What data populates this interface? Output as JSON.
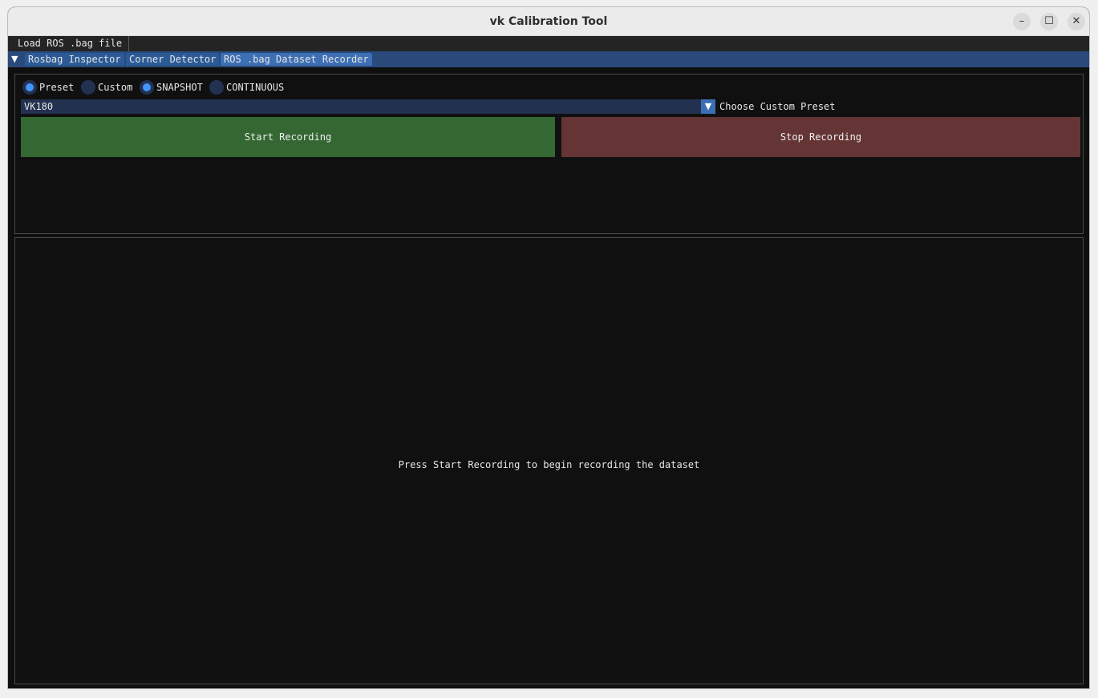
{
  "window": {
    "title": "vk Calibration Tool",
    "controls": {
      "minimize": "–",
      "maximize": "☐",
      "close": "✕"
    }
  },
  "menubar": {
    "items": [
      {
        "label": "Load ROS .bag file"
      }
    ]
  },
  "tabs": {
    "collapse_arrow": "▼",
    "items": [
      {
        "label": "Rosbag Inspector",
        "active": false
      },
      {
        "label": "Corner Detector",
        "active": false
      },
      {
        "label": "ROS .bag Dataset Recorder",
        "active": true
      }
    ]
  },
  "recorder": {
    "source_radios": [
      {
        "label": "Preset",
        "selected": true
      },
      {
        "label": "Custom",
        "selected": false
      }
    ],
    "mode_radios": [
      {
        "label": "SNAPSHOT",
        "selected": true
      },
      {
        "label": "CONTINUOUS",
        "selected": false
      }
    ],
    "preset_combo": {
      "value": "VK180",
      "arrow": "▼",
      "label": "Choose Custom Preset"
    },
    "start_label": "Start Recording",
    "stop_label": "Stop Recording",
    "hint": "Press Start Recording to begin recording the dataset"
  },
  "colors": {
    "start_button": "#346732",
    "stop_button": "#653434",
    "tab_bar": "#294a7a",
    "radio_selected": "#4296f9",
    "frame_bg": "#233150"
  }
}
